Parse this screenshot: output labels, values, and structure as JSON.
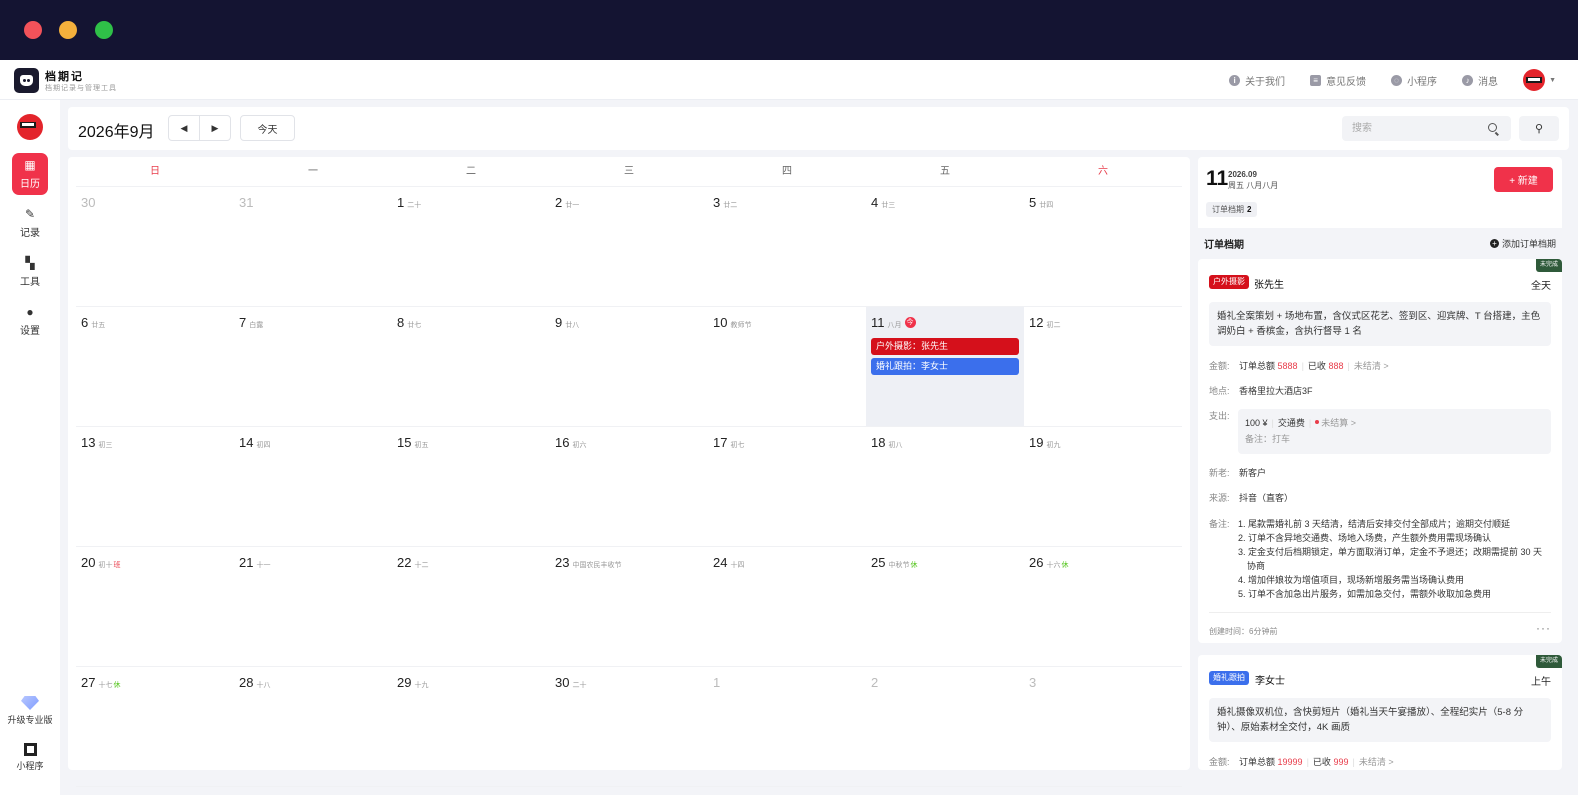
{
  "app": {
    "title": "档期记",
    "subtitle": "档期记录与管理工具"
  },
  "header_nav": [
    {
      "label": "关于我们",
      "icon": "i"
    },
    {
      "label": "意见反馈",
      "icon": "≡"
    },
    {
      "label": "小程序",
      "icon": "◌"
    },
    {
      "label": "消息",
      "icon": "♪"
    }
  ],
  "sidebar": {
    "items": [
      {
        "label": "日历",
        "icon": "▦"
      },
      {
        "label": "记录",
        "icon": "✎"
      },
      {
        "label": "工具",
        "icon": "▚"
      },
      {
        "label": "设置",
        "icon": "●"
      }
    ],
    "upgrade": "升级专业版",
    "miniapp": "小程序"
  },
  "toolbar": {
    "month": "2026年9月",
    "prev": "◀",
    "next": "▶",
    "today": "今天",
    "search_placeholder": "搜索",
    "filter_icon": "⚲"
  },
  "calendar": {
    "weekdays": [
      "日",
      "一",
      "二",
      "三",
      "四",
      "五",
      "六"
    ],
    "days": [
      {
        "d": "30",
        "l": "",
        "other": true
      },
      {
        "d": "31",
        "l": "",
        "other": true
      },
      {
        "d": "1",
        "l": "二十"
      },
      {
        "d": "2",
        "l": "廿一"
      },
      {
        "d": "3",
        "l": "廿二"
      },
      {
        "d": "4",
        "l": "廿三"
      },
      {
        "d": "5",
        "l": "廿四"
      },
      {
        "d": "6",
        "l": "廿五"
      },
      {
        "d": "7",
        "l": "白露"
      },
      {
        "d": "8",
        "l": "廿七"
      },
      {
        "d": "9",
        "l": "廿八"
      },
      {
        "d": "10",
        "l": "教师节"
      },
      {
        "d": "11",
        "l": "八月",
        "today": true,
        "badge": "今",
        "events": [
          {
            "text": "户外摄影：张先生",
            "color": "red"
          },
          {
            "text": "婚礼跟拍：李女士",
            "color": "blue"
          }
        ]
      },
      {
        "d": "12",
        "l": "初二"
      },
      {
        "d": "13",
        "l": "初三"
      },
      {
        "d": "14",
        "l": "初四"
      },
      {
        "d": "15",
        "l": "初五"
      },
      {
        "d": "16",
        "l": "初六"
      },
      {
        "d": "17",
        "l": "初七"
      },
      {
        "d": "18",
        "l": "初八"
      },
      {
        "d": "19",
        "l": "初九"
      },
      {
        "d": "20",
        "l": "初十",
        "tag": "班",
        "tagType": "ban"
      },
      {
        "d": "21",
        "l": "十一"
      },
      {
        "d": "22",
        "l": "十二"
      },
      {
        "d": "23",
        "l": "中国农民丰收节"
      },
      {
        "d": "24",
        "l": "十四"
      },
      {
        "d": "25",
        "l": "中秋节",
        "tag": "休",
        "tagType": "xiu"
      },
      {
        "d": "26",
        "l": "十六",
        "tag": "休",
        "tagType": "xiu"
      },
      {
        "d": "27",
        "l": "十七",
        "tag": "休",
        "tagType": "xiu"
      },
      {
        "d": "28",
        "l": "十八"
      },
      {
        "d": "29",
        "l": "十九"
      },
      {
        "d": "30",
        "l": "二十"
      },
      {
        "d": "1",
        "l": "",
        "other": true
      },
      {
        "d": "2",
        "l": "",
        "other": true
      },
      {
        "d": "3",
        "l": "",
        "other": true
      }
    ]
  },
  "panel": {
    "day": "11",
    "year_month": "2026.09",
    "weekday_lunar": "周五 八月八月",
    "new_button": "+ 新建",
    "count_label": "订单档期",
    "count_value": "2",
    "section_title": "订单档期",
    "add_link": "添加订单档期"
  },
  "orders": [
    {
      "status": "未完成",
      "type": "户外摄影",
      "name": "张先生",
      "time": "全天",
      "desc": "婚礼全案策划 + 场地布置，含仪式区花艺、签到区、迎宾牌、T 台搭建，主色调奶白 + 香槟金，含执行督导 1 名",
      "amount_label": "金额:",
      "total_label": "订单总额",
      "total": "5888",
      "paid_label": "已收",
      "paid": "888",
      "unsettled": "未结清 >",
      "location_label": "地点:",
      "location": "香格里拉大酒店3F",
      "expense_label": "支出:",
      "expense_amount": "100 ¥",
      "expense_type": "交通费",
      "expense_status": "未结算 >",
      "expense_note": "备注：打车",
      "customer_label": "新老:",
      "customer": "新客户",
      "source_label": "来源:",
      "source": "抖音（直客）",
      "notes_label": "备注:",
      "notes": [
        "1. 尾款需婚礼前 3 天结清，结清后安排交付全部成片；逾期交付顺延",
        "2. 订单不含异地交通费、场地入场费，产生额外费用需现场确认",
        "3. 定金支付后档期锁定，单方面取消订单，定金不予退还；改期需提前 30 天协商",
        "4. 增加伴娘妆为增值项目，现场新增服务需当场确认费用",
        "5. 订单不含加急出片服务，如需加急交付，需额外收取加急费用"
      ],
      "created": "创建时间：6分钟前",
      "more": "···"
    },
    {
      "status": "未完成",
      "type": "婚礼跟拍",
      "name": "李女士",
      "time": "上午",
      "desc": "婚礼摄像双机位，含快剪短片（婚礼当天午宴播放）、全程纪实片（5-8 分钟）、原始素材全交付，4K 画质",
      "amount_label": "金额:",
      "total_label": "订单总额",
      "total": "19999",
      "paid_label": "已收",
      "paid": "999",
      "unsettled": "未结清 >"
    }
  ]
}
